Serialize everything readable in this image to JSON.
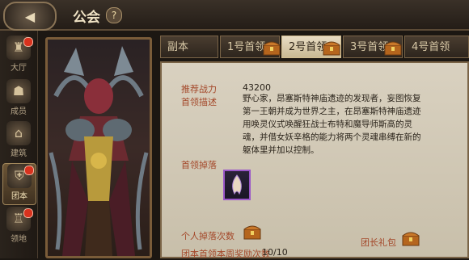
{
  "header": {
    "title": "公会",
    "help_label": "?"
  },
  "sidebar": {
    "items": [
      {
        "label": "大厅",
        "badge": true
      },
      {
        "label": "成员",
        "badge": false
      },
      {
        "label": "建筑",
        "badge": false
      },
      {
        "label": "团本",
        "badge": true,
        "active": true
      },
      {
        "label": "领地",
        "badge": true
      }
    ]
  },
  "tabs": [
    {
      "label": "副本",
      "active": false,
      "chest": false
    },
    {
      "label": "1号首领",
      "active": false,
      "chest": true
    },
    {
      "label": "2号首领",
      "active": true,
      "chest": true
    },
    {
      "label": "3号首领",
      "active": false,
      "chest": true
    },
    {
      "label": "4号首领",
      "active": false,
      "chest": false
    }
  ],
  "boss": {
    "power_label": "推荐战力",
    "power_value": "43200",
    "desc_label": "首领描述",
    "desc_text": "野心家，昂塞斯特神庙遗迹的发现者，妄图恢复第一王朝并成为世界之主，在昂塞斯特神庙遗迹用唤灵仪式唤醒狂战士布特和魔导师斯高的灵魂，并借女妖辛格的能力将两个灵魂串缚在新的躯体里并加以控制。",
    "drop_label": "首领掉落"
  },
  "footer": {
    "personal_drop_label": "个人掉落次数",
    "leader_gift_label": "团长礼包",
    "weekly_reward_label": "团本首领本周奖励次数",
    "weekly_reward_value": "10/10"
  },
  "colors": {
    "accent": "#a4482a",
    "panel": "#d9d1c0",
    "frame": "#7a6447"
  }
}
